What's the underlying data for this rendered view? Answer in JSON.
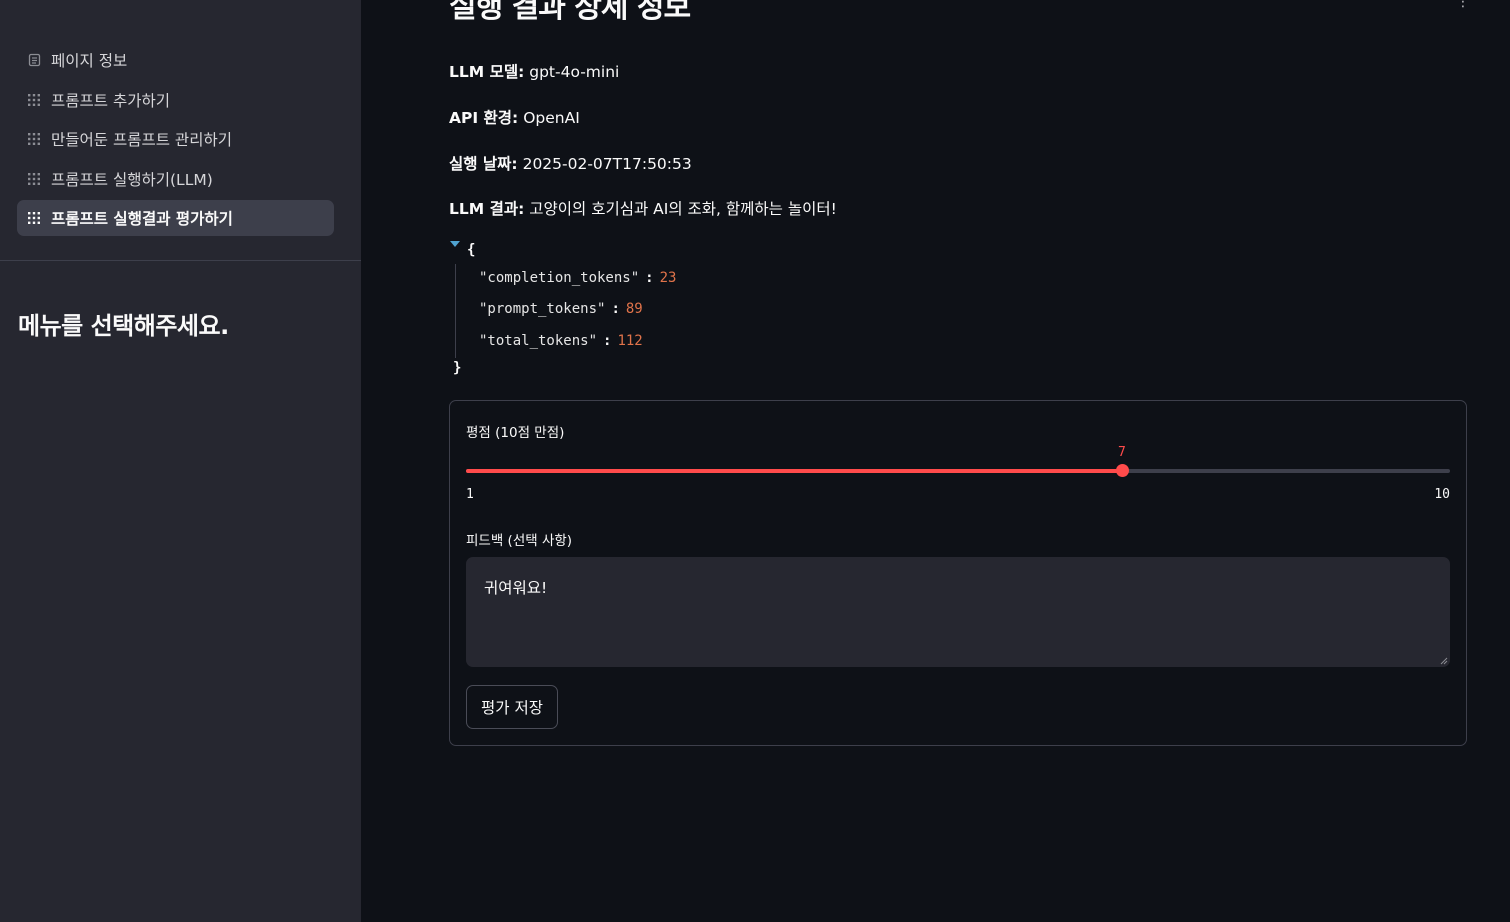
{
  "sidebar": {
    "items": [
      {
        "label": "페이지 정보",
        "icon": "page-icon"
      },
      {
        "label": "프롬프트 추가하기",
        "icon": "grid-icon"
      },
      {
        "label": "만들어둔 프롬프트 관리하기",
        "icon": "grid-icon"
      },
      {
        "label": "프롬프트 실행하기(LLM)",
        "icon": "grid-icon"
      },
      {
        "label": "프롬프트 실행결과 평가하기",
        "icon": "grid-icon",
        "active": true
      }
    ],
    "heading": "메뉴를 선택해주세요."
  },
  "main": {
    "title": "실행 결과 상세 정보",
    "model": {
      "label": "LLM 모델:",
      "value": "gpt-4o-mini"
    },
    "api": {
      "label": "API 환경:",
      "value": "OpenAI"
    },
    "date": {
      "label": "실행 날짜:",
      "value": "2025-02-07T17:50:53"
    },
    "result": {
      "label": "LLM 결과:",
      "value": "고양이의 호기심과 AI의 조화, 함께하는 놀이터!"
    },
    "json": {
      "open": "{",
      "close": "}",
      "rows": [
        {
          "key": "\"completion_tokens\"",
          "value": "23"
        },
        {
          "key": "\"prompt_tokens\"",
          "value": "89"
        },
        {
          "key": "\"total_tokens\"",
          "value": "112"
        }
      ]
    }
  },
  "form": {
    "rating_label": "평점 (10점 만점)",
    "slider": {
      "min": 1,
      "max": 10,
      "value": 7,
      "min_label": "1",
      "max_label": "10",
      "value_label": "7"
    },
    "feedback_label": "피드백 (선택 사항)",
    "feedback_value": "귀여워요!",
    "save_label": "평가 저장"
  },
  "colors": {
    "accent": "#ff4b4b",
    "sidebar_bg": "#262730",
    "main_bg": "#0e1117",
    "json_number": "#e0734a"
  }
}
